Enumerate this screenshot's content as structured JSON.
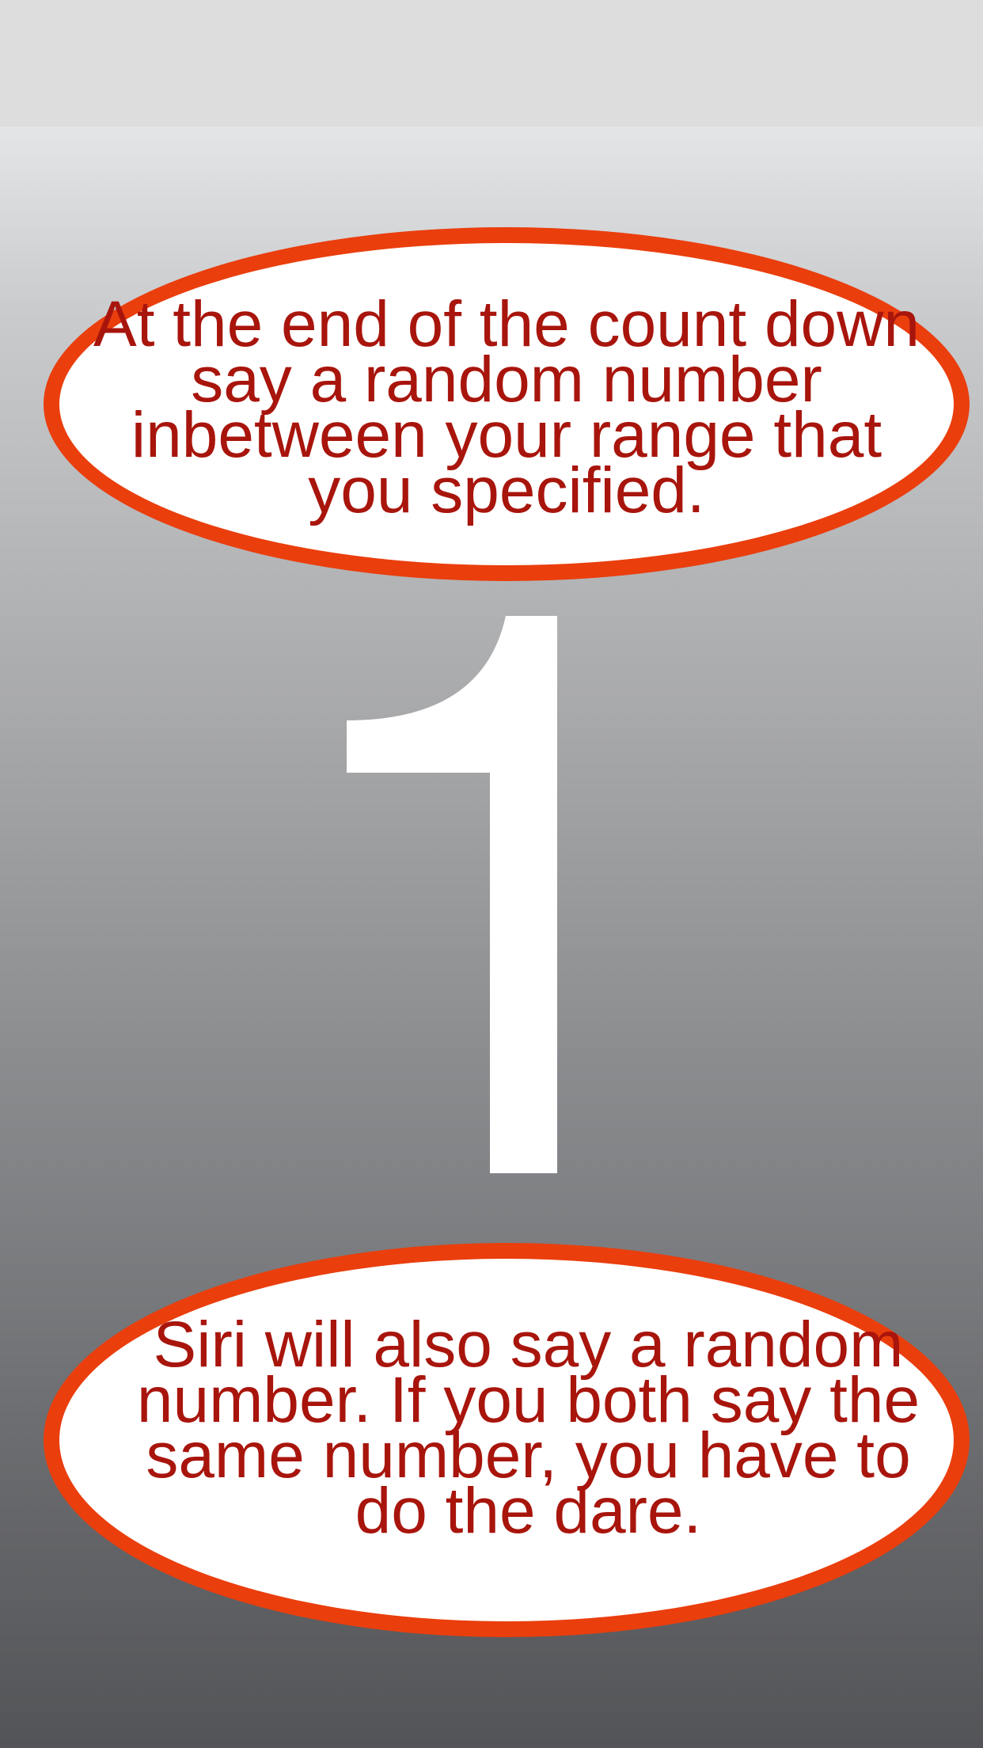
{
  "countdown": {
    "value": "1"
  },
  "instructions": {
    "top": "At the end of the count down say a random number inbetween your range that you specified.",
    "bottom": "Siri will also say a random number. If you both say the same number, you have to do the dare."
  },
  "colors": {
    "bubble_border": "#ea3e0d",
    "bubble_fill": "#ffffff",
    "bubble_text": "#a8150c",
    "digit": "#ffffff"
  }
}
